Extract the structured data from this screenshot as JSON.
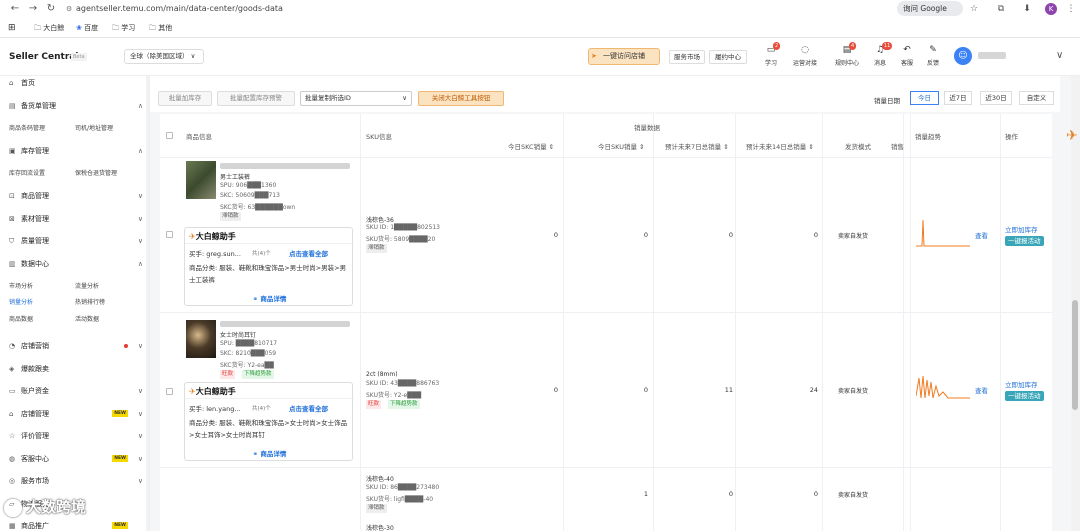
{
  "browser": {
    "url": "agentseller.temu.com/main/data-center/goods-data",
    "google_pill": "询问 Google",
    "bookmarks": [
      "大白鲸",
      "百度",
      "学习",
      "其他"
    ]
  },
  "header": {
    "brand": "Seller Central",
    "beta": "Beta",
    "region": "全球（除美国区域）",
    "visit_shop": "一键访问店铺",
    "service_market": "服务市场",
    "fulfillment": "履约中心",
    "icons": [
      {
        "label": "学习",
        "badge": "2",
        "icon": "graduation-icon"
      },
      {
        "label": "运营对接",
        "badge": "",
        "icon": "chat-icon"
      },
      {
        "label": "规则中心",
        "badge": "4",
        "icon": "rules-icon"
      },
      {
        "label": "消息",
        "badge": "11",
        "icon": "bell-icon"
      },
      {
        "label": "客服",
        "badge": "",
        "icon": "headset-icon"
      },
      {
        "label": "反馈",
        "badge": "",
        "icon": "feedback-icon"
      }
    ]
  },
  "sidebar": {
    "groups": [
      {
        "label": "首页",
        "icon": "home-icon",
        "chevron": ""
      },
      {
        "label": "备货单管理",
        "icon": "doc-icon",
        "chevron": "^"
      },
      {
        "label": "库存管理",
        "icon": "box-icon",
        "chevron": "^"
      },
      {
        "label": "商品管理",
        "icon": "bag-icon",
        "chevron": "v"
      },
      {
        "label": "素材管理",
        "icon": "image-icon",
        "chevron": "v"
      },
      {
        "label": "质量管理",
        "icon": "shield-icon",
        "chevron": "v"
      },
      {
        "label": "数据中心",
        "icon": "chart-icon",
        "chevron": "^"
      },
      {
        "label": "店铺营销",
        "icon": "megaphone-icon",
        "chevron": "v"
      },
      {
        "label": "爆款跟卖",
        "icon": "fire-icon",
        "chevron": ""
      },
      {
        "label": "账户资金",
        "icon": "wallet-icon",
        "chevron": "v"
      },
      {
        "label": "店铺管理",
        "icon": "store-icon",
        "chevron": "v"
      },
      {
        "label": "评价管理",
        "icon": "star-icon",
        "chevron": "v"
      },
      {
        "label": "客服中心",
        "icon": "headset-icon",
        "chevron": "v"
      },
      {
        "label": "服务市场",
        "icon": "market-icon",
        "chevron": "v"
      },
      {
        "label": "物流服务",
        "icon": "truck-icon",
        "chevron": ""
      },
      {
        "label": "商品推广",
        "icon": "promo-icon",
        "chevron": ""
      }
    ],
    "subs": {
      "stock_order": [
        "商品条码管理",
        "司机/地址管理"
      ],
      "inventory": [
        "库存回流设置",
        "保税仓退货管理"
      ],
      "data_center": [
        "市场分析",
        "流量分析",
        "销量分析",
        "热销排行榜",
        "商品数据",
        "活动数据"
      ]
    },
    "new_label": "NEW"
  },
  "toolbar": {
    "btn1": "批量加库存",
    "btn2": "批量配置库存预警",
    "batch_select": "批量复制所选ID",
    "close_tool": "关闭大白鲸工具按钮",
    "date_label": "销量日期",
    "date_tabs": [
      "今日",
      "近7日",
      "近30日",
      "自定义"
    ]
  },
  "table": {
    "headers": {
      "product": "商品信息",
      "sku": "SKU信息",
      "sales_group": "销量数据",
      "today_skc": "今日SKC销量 ⇕",
      "today_sku": "今日SKU销量 ⇕",
      "pred7": "预计未来7日总销量 ⇕",
      "pred14": "预计未来14日总销量 ⇕",
      "ship_mode": "发货模式",
      "sales_more": "销售",
      "trend": "销量趋势",
      "ops": "操作"
    },
    "rows": [
      {
        "title": "男士工装裤",
        "spu": "SPU: 906███1360",
        "skc": "SKC: 50609███713",
        "skc_no": "SKC货号: 63██████own",
        "tag": "滞销款",
        "buyer": "买手: greg.sun...",
        "buyer_count": "共(4)个",
        "view_all": "点击查看全部",
        "category": "商品分类: 服装、鞋靴和珠宝饰品>男士时尚>男装>男士工装裤",
        "detail": "商品详情",
        "sku_name": "浅棕色-36",
        "sku_id": "SKU ID: 1█████802513",
        "sku_no": "SKU货号: 5809████20",
        "sku_tag": "滞销款",
        "today_skc": "0",
        "today_sku": "0",
        "pred7": "0",
        "pred14": "0",
        "ship": "卖家自发货",
        "view": "查看",
        "add_stock": "立即加库存",
        "report": "一键报活动"
      },
      {
        "title": "女士时尚耳钉",
        "spu": "SPU: ████810717",
        "skc": "SKC: 8210███059",
        "skc_no": "SKC货号: Y2-ea██",
        "tag": "旺款",
        "tag2": "下降趋势款",
        "buyer": "买手: len.yang...",
        "buyer_count": "共(4)个",
        "view_all": "点击查看全部",
        "category": "商品分类: 服装、鞋靴和珠宝饰品>女士时尚>女士饰品>女士耳饰>女士时尚耳钉",
        "detail": "商品详情",
        "sku_name": "2ct (8mm)",
        "sku_id": "SKU ID: 43████886763",
        "sku_no": "SKU货号: Y2-e███",
        "sku_tag": "旺款",
        "sku_tag2": "下降趋势款",
        "today_skc": "0",
        "today_sku": "0",
        "pred7": "11",
        "pred14": "24",
        "ship": "卖家自发货",
        "view": "查看",
        "add_stock": "立即加库存",
        "report": "一键报活动"
      },
      {
        "sku_name": "浅棕色-40",
        "sku_id": "SKU ID: 86████273480",
        "sku_no": "SKU货号: ligfi████-40",
        "sku_tag": "滞销款",
        "sku_name2": "浅棕色-30",
        "today_skc": "1",
        "today_sku": "0",
        "pred7": "0",
        "ship": "卖家自发货"
      }
    ]
  },
  "watermark": "大数跨境"
}
